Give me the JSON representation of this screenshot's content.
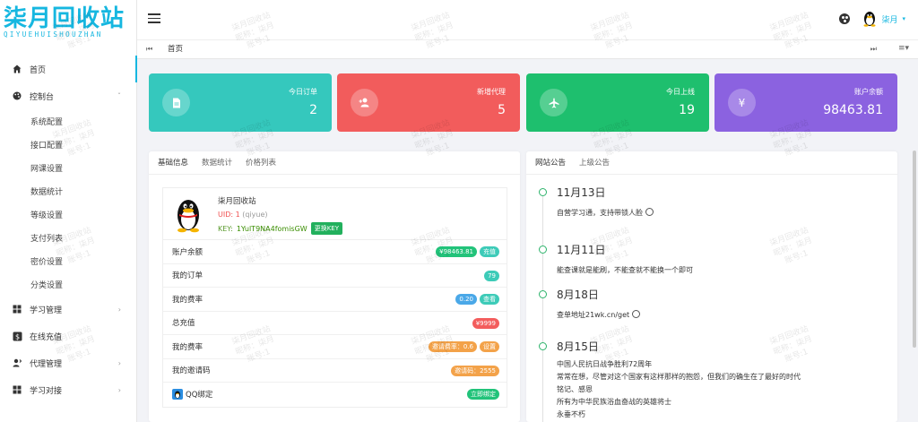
{
  "logo": {
    "title": "柒月回收站",
    "subtitle": "QIYUEHUISHOUZHAN"
  },
  "sidebar": {
    "items": [
      {
        "label": "首页",
        "icon": "home-icon",
        "active": true
      },
      {
        "label": "控制台",
        "icon": "palette-icon",
        "chevron": "ˇ"
      }
    ],
    "sub_items": [
      "系统配置",
      "接口配置",
      "网课设置",
      "数据统计",
      "等级设置",
      "支付列表",
      "密价设置",
      "分类设置"
    ],
    "bottom_items": [
      {
        "label": "学习管理",
        "icon": "grid-icon",
        "chevron": "›"
      },
      {
        "label": "在线充值",
        "icon": "dollar-icon"
      },
      {
        "label": "代理管理",
        "icon": "user-icon",
        "chevron": "›"
      },
      {
        "label": "学习对接",
        "icon": "grid-icon",
        "chevron": "›"
      }
    ]
  },
  "topbar": {
    "user_name": "柒月",
    "user_caret": "▾"
  },
  "tabbar": {
    "prev": "⏮",
    "tab": "首页",
    "next": "⏭",
    "more": "≡▾"
  },
  "stats": [
    {
      "label": "今日订单",
      "value": "2",
      "icon": "file-icon",
      "color": "#35c8bd"
    },
    {
      "label": "新增代理",
      "value": "5",
      "icon": "add-user-icon",
      "color": "#f25c5c"
    },
    {
      "label": "今日上线",
      "value": "19",
      "icon": "plane-icon",
      "color": "#1ebf6e"
    },
    {
      "label": "账户余额",
      "value": "98463.81",
      "icon": "yen-icon",
      "color": "#8b62e0"
    }
  ],
  "info_panel": {
    "tabs": [
      "基础信息",
      "数据统计",
      "价格列表"
    ],
    "profile": {
      "name": "柒月回收站",
      "uid_label": "UID: 1",
      "uid_sub": "(qiyue)",
      "key_label": "KEY:",
      "key_value": "1YulT9NA4fomisGW",
      "key_button": "更换KEY"
    },
    "rows": [
      {
        "label": "账户余额",
        "badges": [
          {
            "text": "¥98463.81",
            "cls": "bg-green"
          },
          {
            "text": "充值",
            "cls": "bg-teal"
          }
        ]
      },
      {
        "label": "我的订单",
        "badges": [
          {
            "text": "79",
            "cls": "bg-teal"
          }
        ]
      },
      {
        "label": "我的费率",
        "badges": [
          {
            "text": "0.20",
            "cls": "bg-blue"
          },
          {
            "text": "查看",
            "cls": "bg-teal"
          }
        ]
      },
      {
        "label": "总充值",
        "badges": [
          {
            "text": "¥9999",
            "cls": "bg-red"
          }
        ]
      },
      {
        "label": "我的费率",
        "badges": [
          {
            "text": "邀请费率：0.6",
            "cls": "bg-orange"
          },
          {
            "text": "设置",
            "cls": "bg-orange"
          }
        ]
      },
      {
        "label": "我的邀请码",
        "badges": [
          {
            "text": "邀请码：2555",
            "cls": "bg-orange"
          }
        ]
      },
      {
        "label": "QQ绑定",
        "qq": true,
        "badges": [
          {
            "text": "立即绑定",
            "cls": "bg-green"
          }
        ]
      }
    ]
  },
  "notice_panel": {
    "tabs": [
      "网站公告",
      "上级公告"
    ],
    "items": [
      {
        "date": "11月13日",
        "lines": [
          "自营学习通，支持带锁人脸"
        ],
        "smile": true
      },
      {
        "date": "11月11日",
        "lines": [
          "能查课就是能刷，不能查就不能换一个即可"
        ]
      },
      {
        "date": "8月18日",
        "lines": [
          "查单地址21wk.cn/get"
        ],
        "smile": true
      },
      {
        "date": "8月15日",
        "lines": [
          "中国人民抗日战争胜利72周年",
          "常常在想，尽管对这个国家有这样那样的抱怨，但我们的确生在了最好的时代",
          "铭记、感恩",
          "所有为中华民族浴血奋战的英雄将士",
          "永垂不朽"
        ]
      }
    ]
  },
  "watermark": [
    "柒月回收站",
    "昵称：柒月",
    "账号:1"
  ]
}
